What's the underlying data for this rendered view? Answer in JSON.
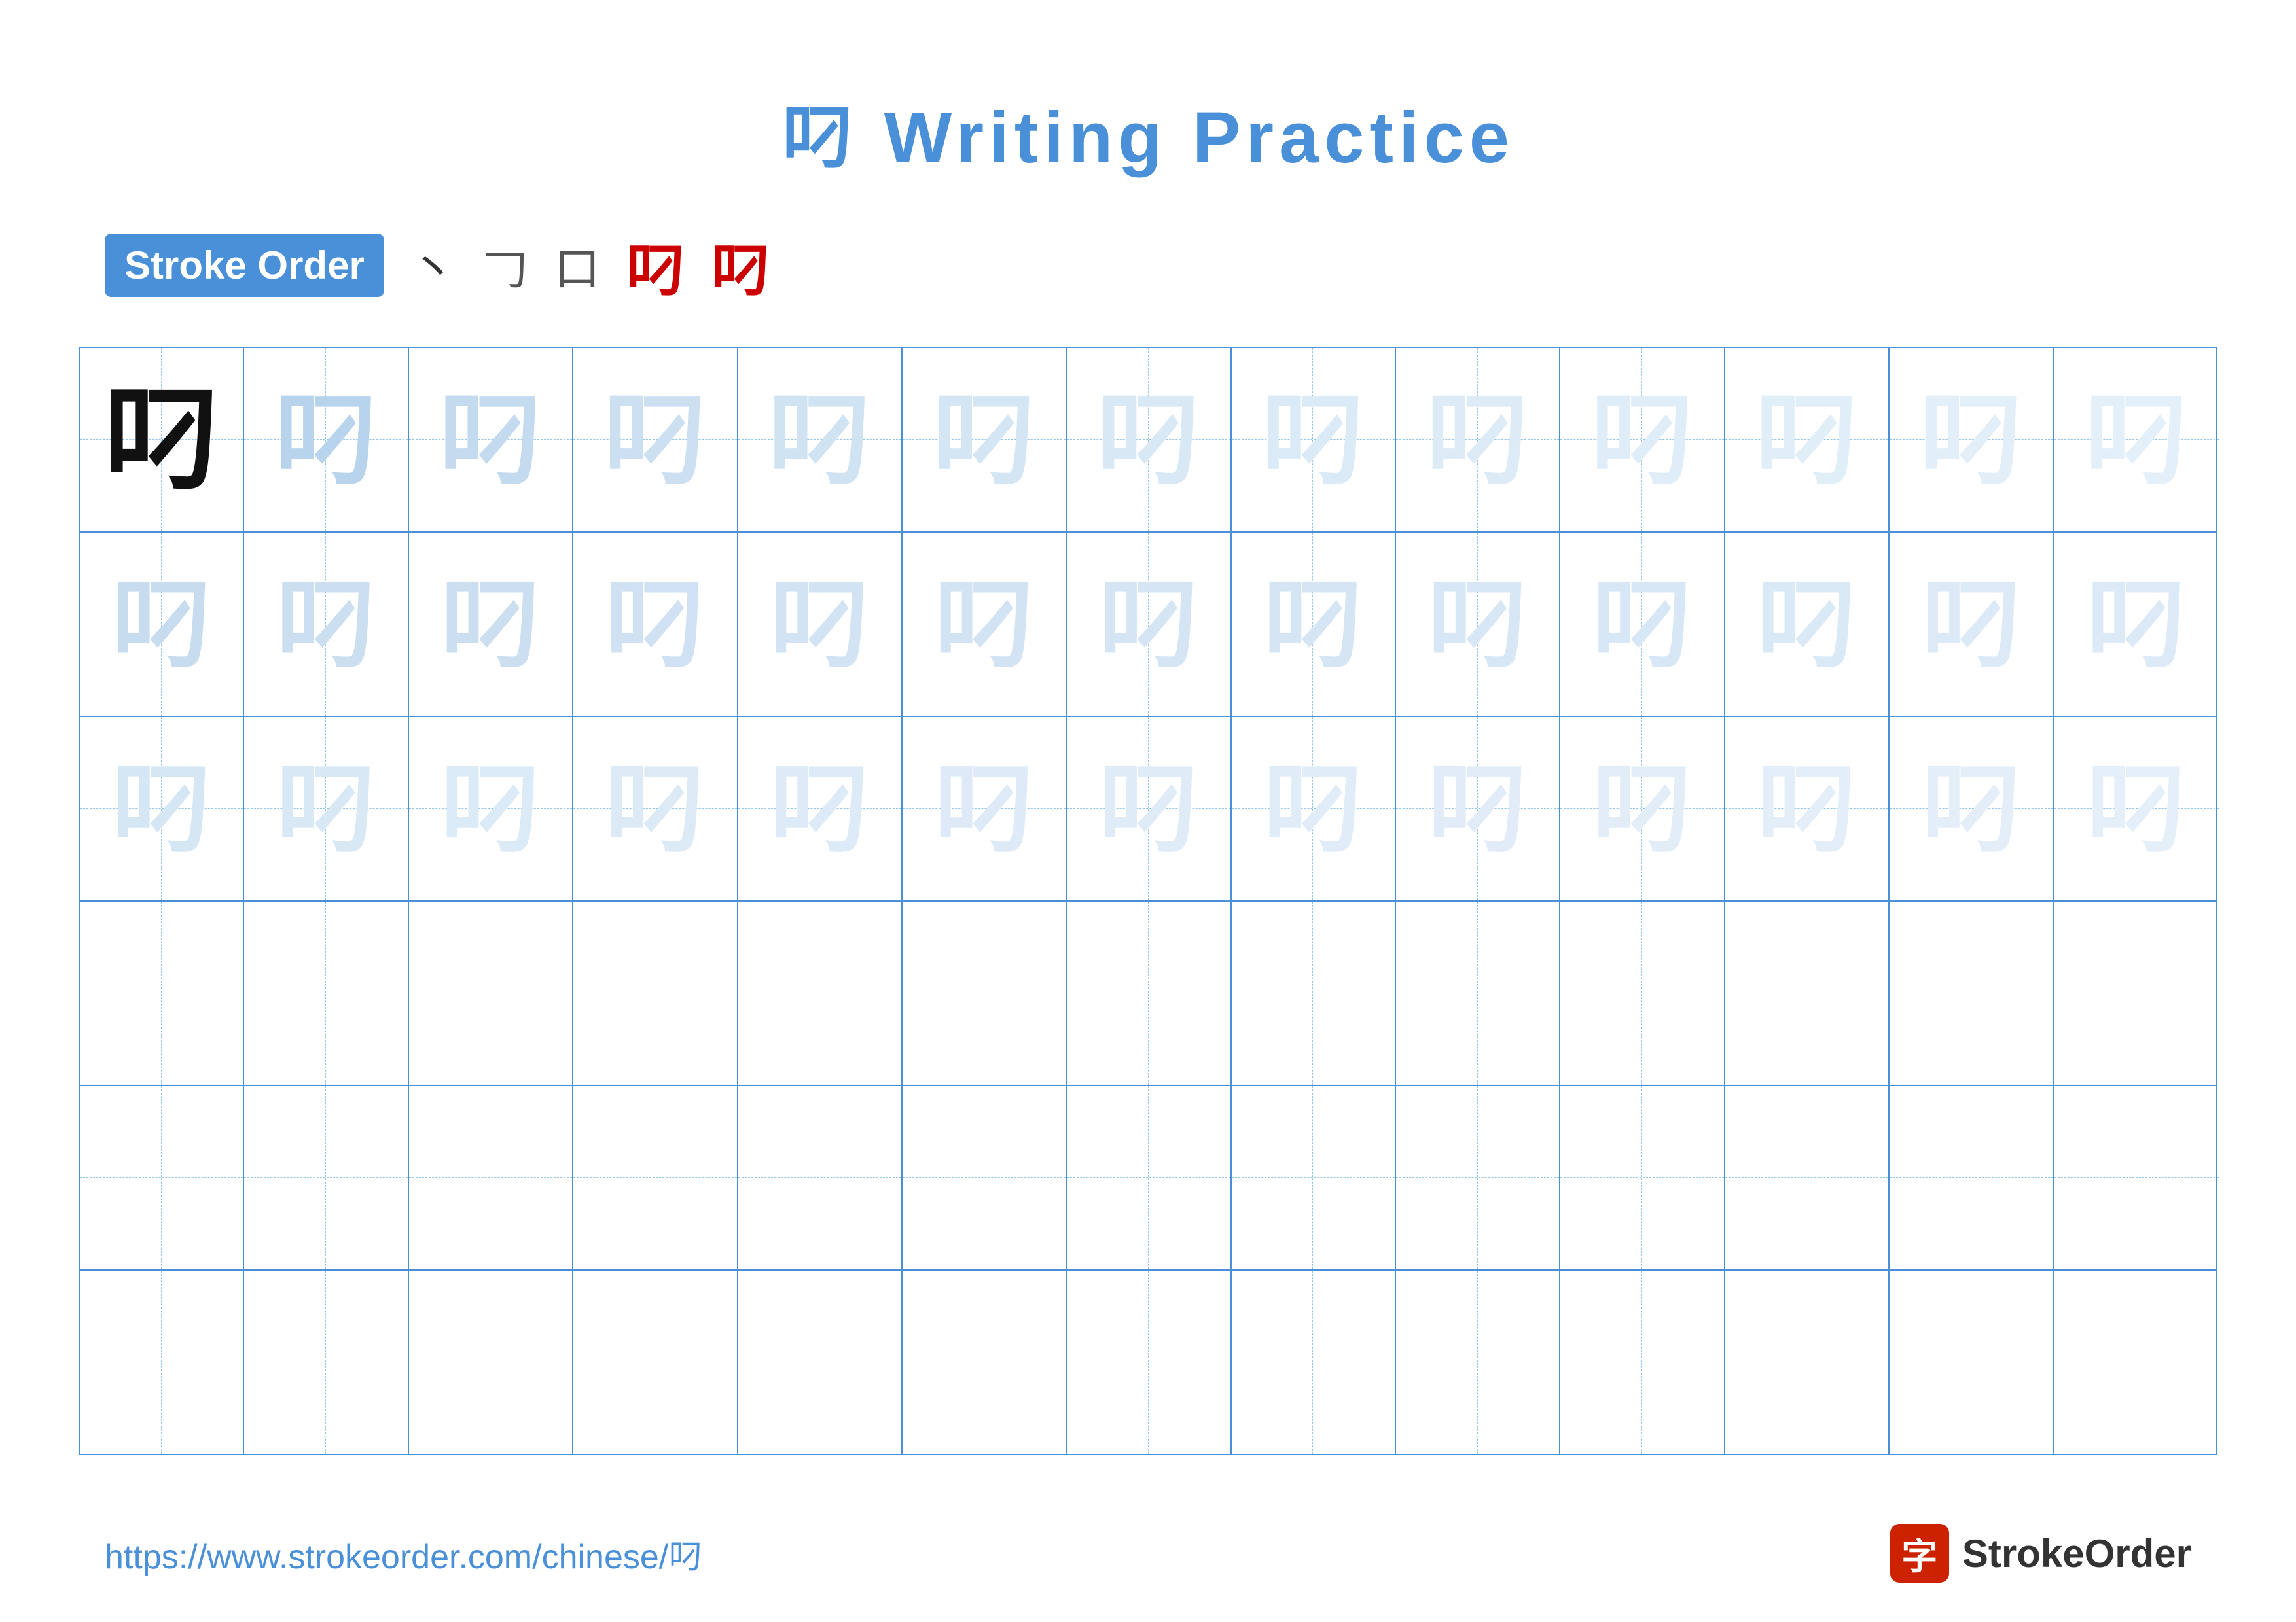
{
  "page": {
    "title": "叼 Writing Practice",
    "character": "叼",
    "stroke_order_label": "Stroke Order",
    "stroke_steps": [
      "丶",
      "𠃌",
      "口",
      "叼",
      "叼"
    ],
    "url": "https://www.strokeorder.com/chinese/叼",
    "brand": "StrokeOrder",
    "grid": {
      "cols": 13,
      "rows": 6
    },
    "colors": {
      "primary": "#4a90d9",
      "stroke_order_bg": "#4a90d9",
      "stroke_order_text": "#ffffff",
      "bold_char": "#111111",
      "medium_char": "#b8d4ec",
      "light_char": "#cce0f5",
      "very_light_char": "#ddedf8",
      "grid_border": "#4a90d9",
      "grid_dashed": "#90c4e8",
      "accent_red": "#cc0000",
      "footer_url": "#4a90d9",
      "brand_icon_bg": "#cc2200"
    }
  }
}
